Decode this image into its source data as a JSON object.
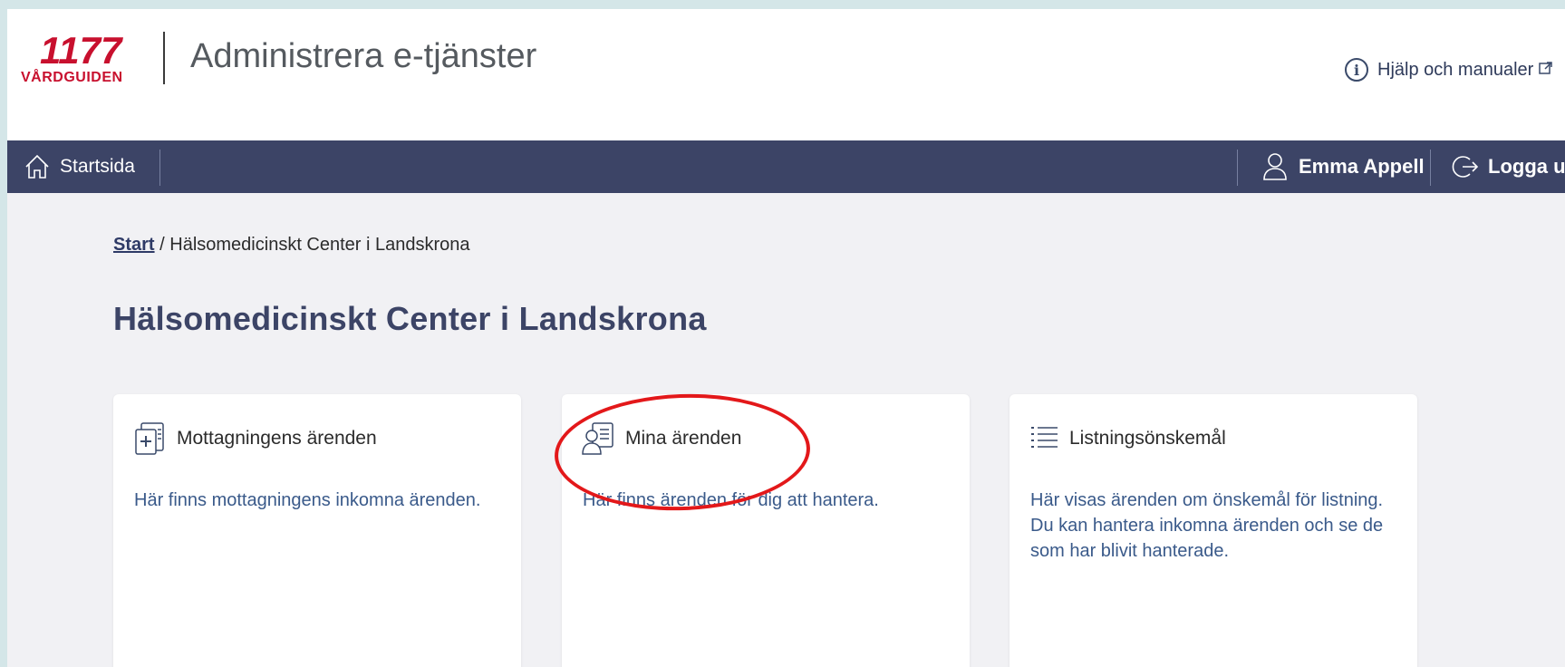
{
  "brand": {
    "logo_number": "1177",
    "logo_text": "VÅRDGUIDEN",
    "app_title": "Administrera e-tjänster"
  },
  "header": {
    "help_link": "Hjälp och manualer"
  },
  "navbar": {
    "home_label": "Startsida",
    "user_name": "Emma Appell",
    "logout_label": "Logga ut"
  },
  "breadcrumb": {
    "start": "Start",
    "separator": "/",
    "current": "Hälsomedicinskt Center i Landskrona"
  },
  "page": {
    "title": "Hälsomedicinskt Center i Landskrona"
  },
  "cards": [
    {
      "icon": "clinic-cases-icon",
      "title": "Mottagningens ärenden",
      "description": "Här finns mottagningens inkomna ärenden."
    },
    {
      "icon": "my-cases-icon",
      "title": "Mina ärenden",
      "description": "Här finns ärenden för dig att hantera."
    },
    {
      "icon": "list-icon",
      "title": "Listningsönskemål",
      "description": "Här visas ärenden om önskemål för listning. Du kan hantera inkomna ärenden och se de som har blivit hanterade."
    }
  ],
  "colors": {
    "brand_red": "#c8102e",
    "navbar_bg": "#3c4466",
    "page_bg": "#f1f1f4",
    "annotation_red": "#e3181a"
  }
}
